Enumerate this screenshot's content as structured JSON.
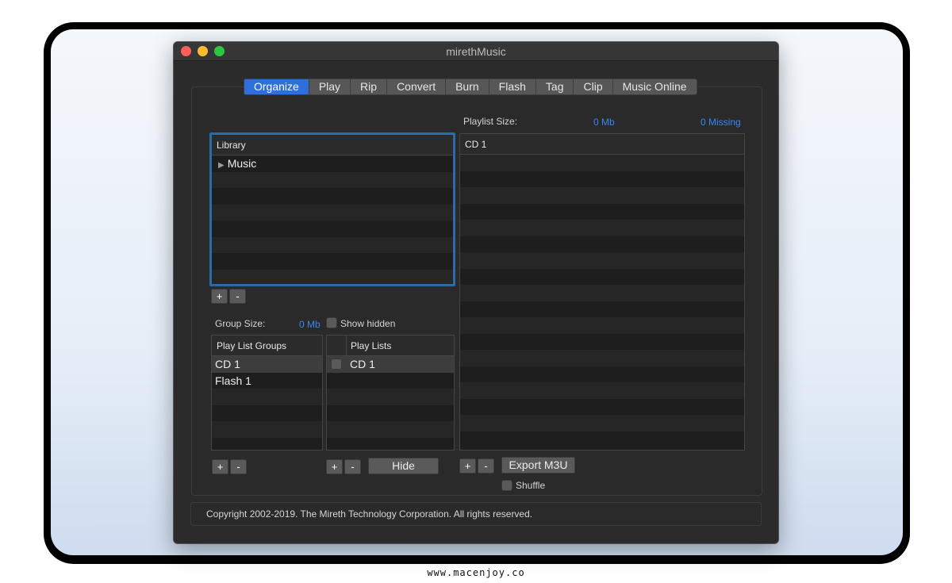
{
  "window": {
    "title": "mirethMusic"
  },
  "tabs": [
    "Organize",
    "Play",
    "Rip",
    "Convert",
    "Burn",
    "Flash",
    "Tag",
    "Clip",
    "Music Online"
  ],
  "active_tab": "Organize",
  "library": {
    "header": "Library",
    "items": [
      "Music"
    ]
  },
  "library_buttons": {
    "add": "+",
    "remove": "-"
  },
  "group": {
    "size_label": "Group Size:",
    "size_value": "0 Mb",
    "show_hidden_label": "Show hidden"
  },
  "play_list_groups": {
    "header": "Play List Groups",
    "items": [
      "CD 1",
      "Flash 1"
    ],
    "selected": "CD 1"
  },
  "play_lists": {
    "header": "Play Lists",
    "items": [
      "CD 1"
    ]
  },
  "group_buttons": {
    "add": "+",
    "remove": "-"
  },
  "playlist_buttons": {
    "add": "+",
    "remove": "-",
    "hide": "Hide"
  },
  "playlist": {
    "size_label": "Playlist Size:",
    "size_value": "0 Mb",
    "missing": "0 Missing",
    "header": "CD 1"
  },
  "playlist_panel_buttons": {
    "add": "+",
    "remove": "-",
    "export": "Export M3U",
    "shuffle": "Shuffle"
  },
  "footer": {
    "copyright": "Copyright 2002-2019.  The Mireth Technology Corporation. All rights reserved."
  },
  "watermark": "www.macenjoy.co",
  "colors": {
    "accent": "#2f6fd9",
    "value_text": "#3a86f0",
    "focus_ring": "#2d6aa8"
  }
}
